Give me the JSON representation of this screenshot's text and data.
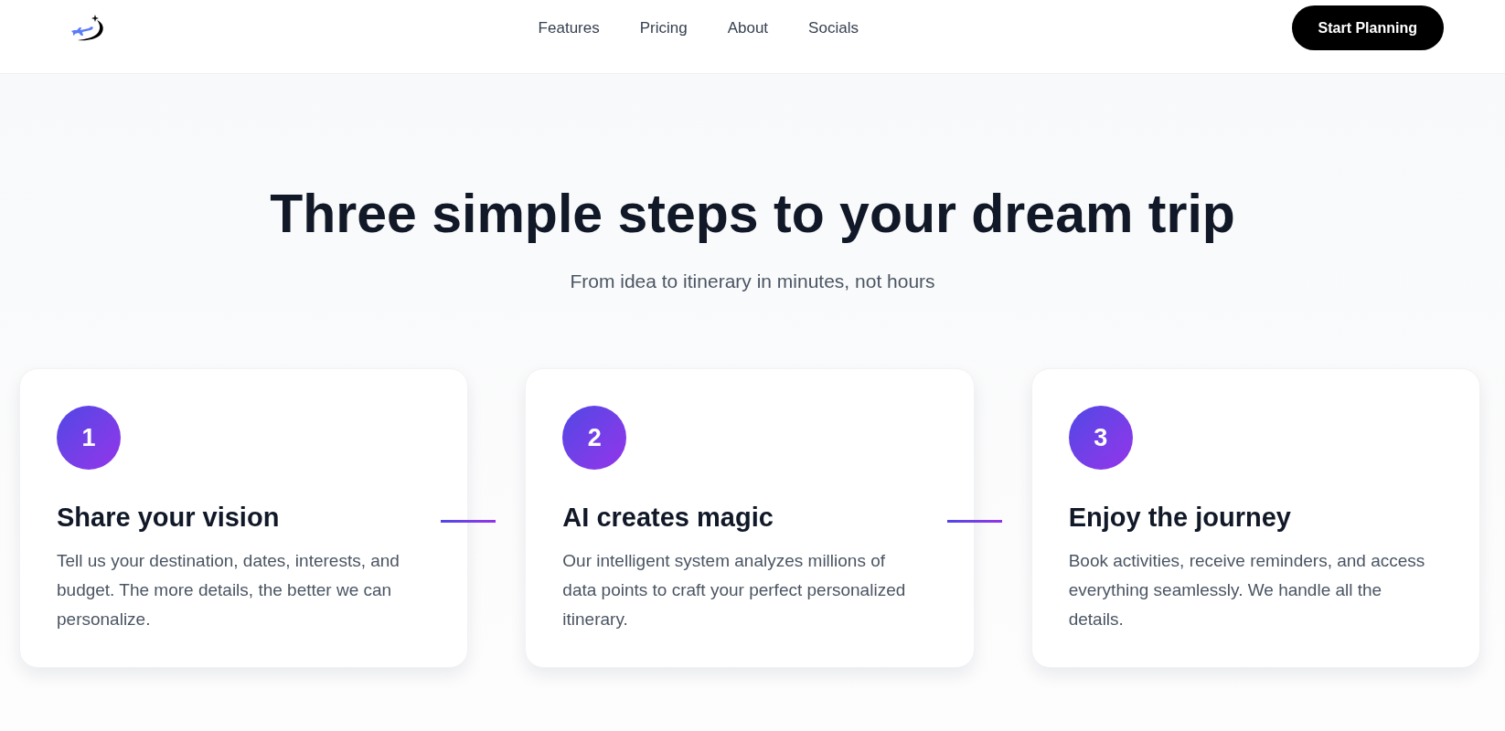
{
  "header": {
    "nav": [
      "Features",
      "Pricing",
      "About",
      "Socials"
    ],
    "cta": "Start Planning"
  },
  "hero": {
    "title": "Three simple steps to your dream trip",
    "subtitle": "From idea to itinerary in minutes, not hours"
  },
  "steps": [
    {
      "number": "1",
      "title": "Share your vision",
      "description": "Tell us your destination, dates, interests, and budget. The more details, the better we can personalize."
    },
    {
      "number": "2",
      "title": "AI creates magic",
      "description": "Our intelligent system analyzes millions of data points to craft your perfect personalized itinerary."
    },
    {
      "number": "3",
      "title": "Enjoy the journey",
      "description": "Book activities, receive reminders, and access everything seamlessly. We handle all the details."
    }
  ]
}
